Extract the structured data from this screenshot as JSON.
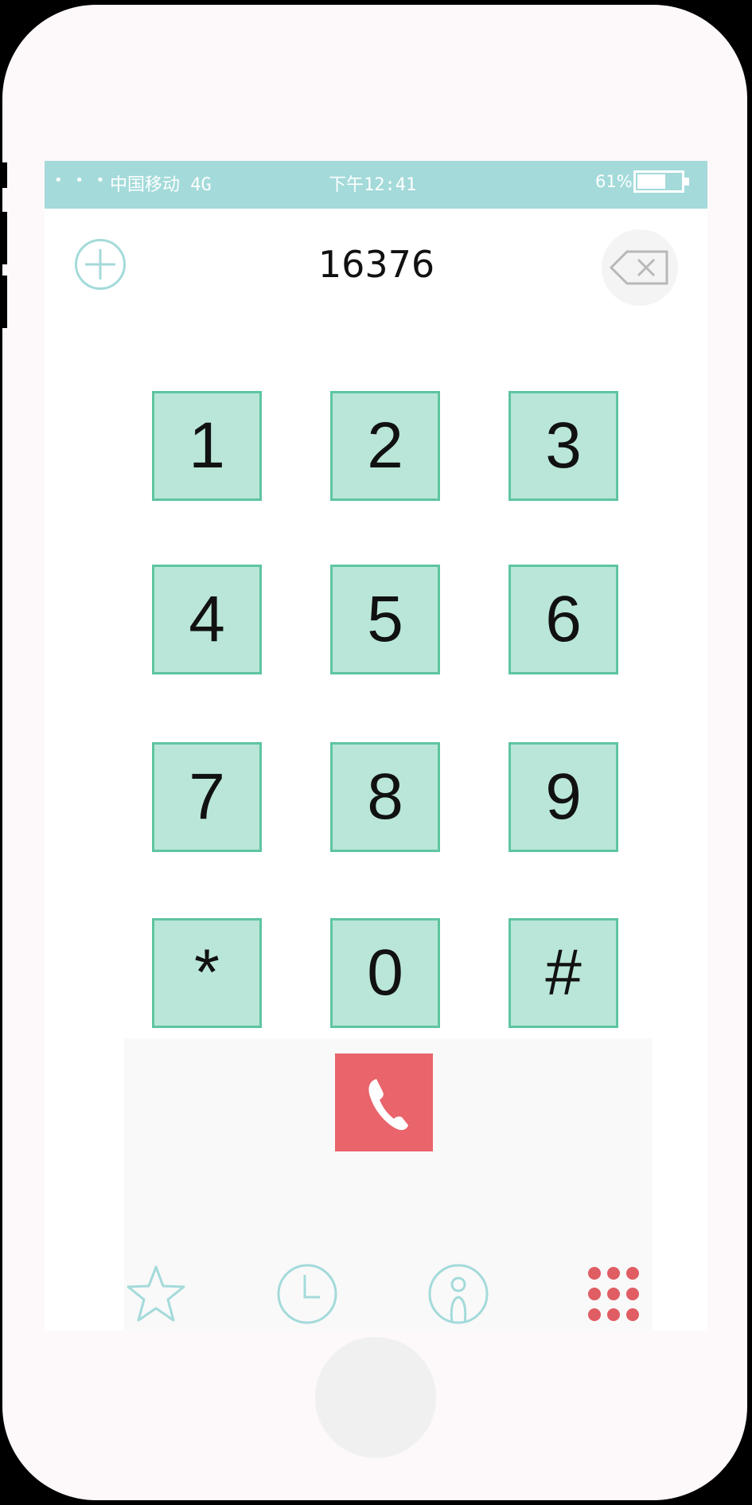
{
  "status_bar": {
    "signal_dots": "• • •",
    "carrier": "中国移动 4G",
    "time": "下午12:41",
    "battery_percent": "61%",
    "battery_level": 0.61
  },
  "dialer": {
    "number": "16376",
    "keys": [
      "1",
      "2",
      "3",
      "4",
      "5",
      "6",
      "7",
      "8",
      "9",
      "*",
      "0",
      "#"
    ]
  },
  "tab_bar": {
    "tabs": [
      {
        "icon": "star-icon",
        "active": false
      },
      {
        "icon": "clock-icon",
        "active": false
      },
      {
        "icon": "contact-icon",
        "active": false
      },
      {
        "icon": "keypad-icon",
        "active": true
      }
    ]
  },
  "colors": {
    "status_bar": "#a4dada",
    "key_fill": "#b9e6d8",
    "key_border": "#5ec5a0",
    "call_button": "#e9646b",
    "active_tab": "#e05d64",
    "inactive_tab": "#a4dada"
  }
}
